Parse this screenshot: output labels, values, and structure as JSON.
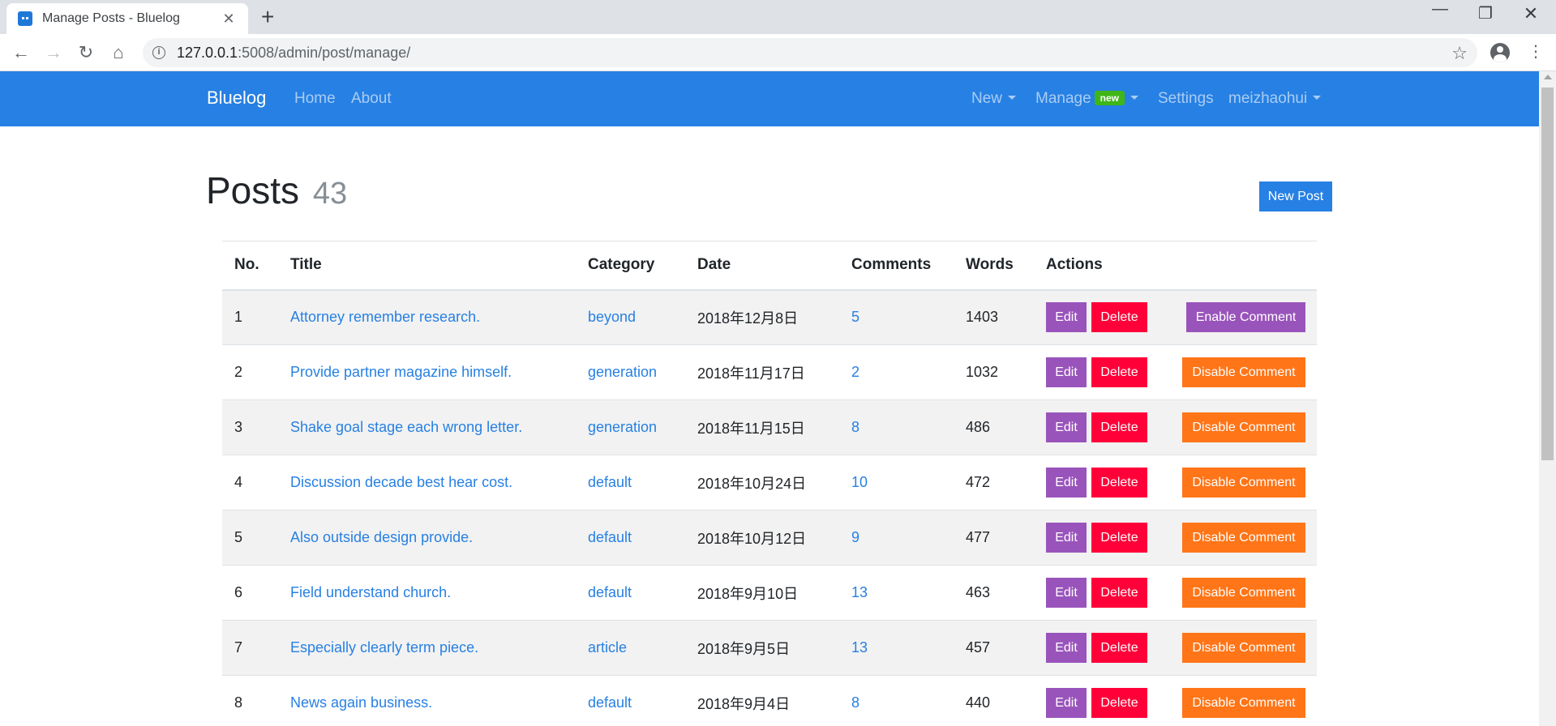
{
  "browser": {
    "tab_title": "Manage Posts - Bluelog",
    "url_host": "127.0.0.1",
    "url_rest": ":5008/admin/post/manage/"
  },
  "navbar": {
    "brand": "Bluelog",
    "home": "Home",
    "about": "About",
    "new": "New",
    "manage": "Manage",
    "manage_badge": "new",
    "settings": "Settings",
    "user": "meizhaohui"
  },
  "page": {
    "title": "Posts",
    "count": "43",
    "new_post_button": "New Post"
  },
  "table": {
    "headers": [
      "No.",
      "Title",
      "Category",
      "Date",
      "Comments",
      "Words",
      "Actions"
    ],
    "edit_label": "Edit",
    "delete_label": "Delete",
    "rows": [
      {
        "no": "1",
        "title": "Attorney remember research.",
        "category": "beyond",
        "date": "2018年12月8日",
        "comments": "5",
        "words": "1403",
        "toggle": "Enable Comment"
      },
      {
        "no": "2",
        "title": "Provide partner magazine himself.",
        "category": "generation",
        "date": "2018年11月17日",
        "comments": "2",
        "words": "1032",
        "toggle": "Disable Comment"
      },
      {
        "no": "3",
        "title": "Shake goal stage each wrong letter.",
        "category": "generation",
        "date": "2018年11月15日",
        "comments": "8",
        "words": "486",
        "toggle": "Disable Comment"
      },
      {
        "no": "4",
        "title": "Discussion decade best hear cost.",
        "category": "default",
        "date": "2018年10月24日",
        "comments": "10",
        "words": "472",
        "toggle": "Disable Comment"
      },
      {
        "no": "5",
        "title": "Also outside design provide.",
        "category": "default",
        "date": "2018年10月12日",
        "comments": "9",
        "words": "477",
        "toggle": "Disable Comment"
      },
      {
        "no": "6",
        "title": "Field understand church.",
        "category": "default",
        "date": "2018年9月10日",
        "comments": "13",
        "words": "463",
        "toggle": "Disable Comment"
      },
      {
        "no": "7",
        "title": "Especially clearly term piece.",
        "category": "article",
        "date": "2018年9月5日",
        "comments": "13",
        "words": "457",
        "toggle": "Disable Comment"
      },
      {
        "no": "8",
        "title": "News again business.",
        "category": "default",
        "date": "2018年9月4日",
        "comments": "8",
        "words": "440",
        "toggle": "Disable Comment"
      }
    ]
  },
  "colors": {
    "primary": "#2780e3",
    "edit": "#9954bb",
    "delete": "#ff0039",
    "disable": "#ff7518",
    "badge": "#3fb618"
  }
}
